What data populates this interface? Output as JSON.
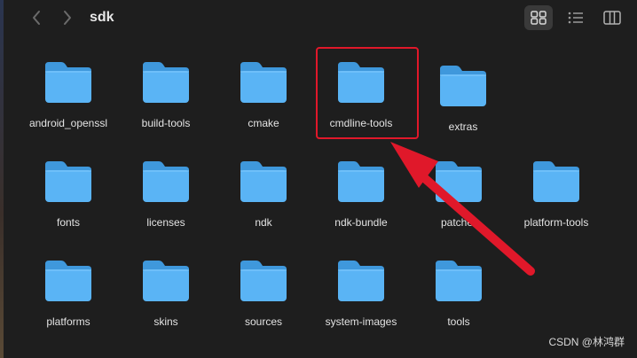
{
  "window": {
    "title": "sdk"
  },
  "toolbar": {
    "back_icon": "chevron-left-icon",
    "forward_icon": "chevron-right-icon",
    "views": [
      "icon-view",
      "list-view",
      "column-view"
    ],
    "active_view": "icon-view"
  },
  "folders": [
    {
      "name": "android_openssl"
    },
    {
      "name": "build-tools"
    },
    {
      "name": "cmake"
    },
    {
      "name": "cmdline-tools"
    },
    {
      "name": "extras"
    },
    {
      "name": "fonts"
    },
    {
      "name": "licenses"
    },
    {
      "name": "ndk"
    },
    {
      "name": "ndk-bundle"
    },
    {
      "name": "patcher"
    },
    {
      "name": "platform-tools"
    },
    {
      "name": "platforms"
    },
    {
      "name": "skins"
    },
    {
      "name": "sources"
    },
    {
      "name": "system-images"
    },
    {
      "name": "tools"
    }
  ],
  "annotation": {
    "highlighted_folder": "cmdline-tools",
    "color": "#e0182a"
  },
  "watermark": "CSDN @林鸿群",
  "colors": {
    "background": "#1e1e1e",
    "folder": "#5ab4f5",
    "folder_tab": "#3f98dc"
  }
}
